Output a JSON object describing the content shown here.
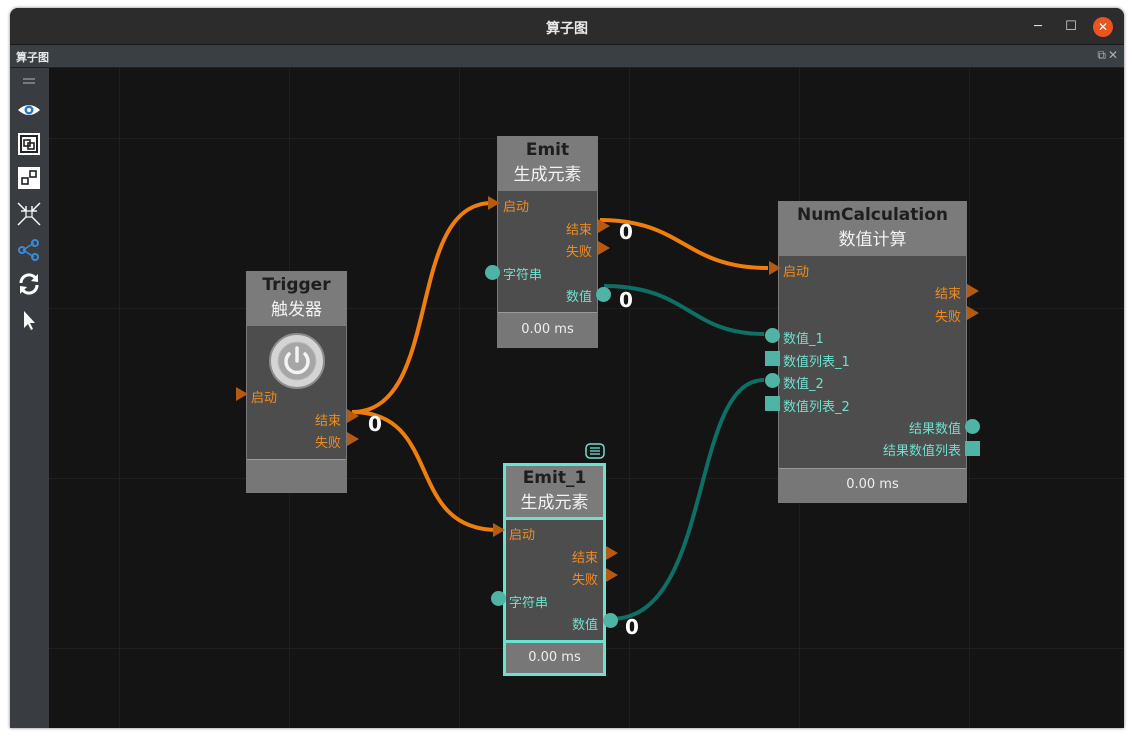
{
  "window": {
    "title": "算子图"
  },
  "panel": {
    "title": "算子图",
    "controls": "⧉✕"
  },
  "toolbar": [
    "grip-icon",
    "eye-icon",
    "fit-view-icon",
    "layout-icon",
    "collapse-icon",
    "share-graph-icon",
    "refresh-icon",
    "pointer-icon"
  ],
  "nodes": {
    "trigger": {
      "name": "Trigger",
      "subtitle": "触发器",
      "in_start": "启动",
      "out_end": "结束",
      "out_fail": "失败"
    },
    "emit": {
      "name": "Emit",
      "subtitle": "生成元素",
      "in_start": "启动",
      "out_end": "结束",
      "out_fail": "失败",
      "in_string": "字符串",
      "out_value": "数值",
      "time": "0.00 ms"
    },
    "emit1": {
      "name": "Emit_1",
      "subtitle": "生成元素",
      "in_start": "启动",
      "out_end": "结束",
      "out_fail": "失败",
      "in_string": "字符串",
      "out_value": "数值",
      "time": "0.00 ms"
    },
    "numcalc": {
      "name": "NumCalculation",
      "subtitle": "数值计算",
      "in_start": "启动",
      "out_end": "结束",
      "out_fail": "失败",
      "in_value1": "数值_1",
      "in_list1": "数值列表_1",
      "in_value2": "数值_2",
      "in_list2": "数值列表_2",
      "out_result": "结果数值",
      "out_result_list": "结果数值列表",
      "time": "0.00 ms"
    }
  },
  "wire_labels": {
    "emit_end": "0",
    "emit_value": "0",
    "trigger_end": "0",
    "emit1_value": "0"
  },
  "colors": {
    "flow_wire": "#f07f0a",
    "data_wire": "#0d6f66",
    "selection": "#6ee0cf"
  }
}
